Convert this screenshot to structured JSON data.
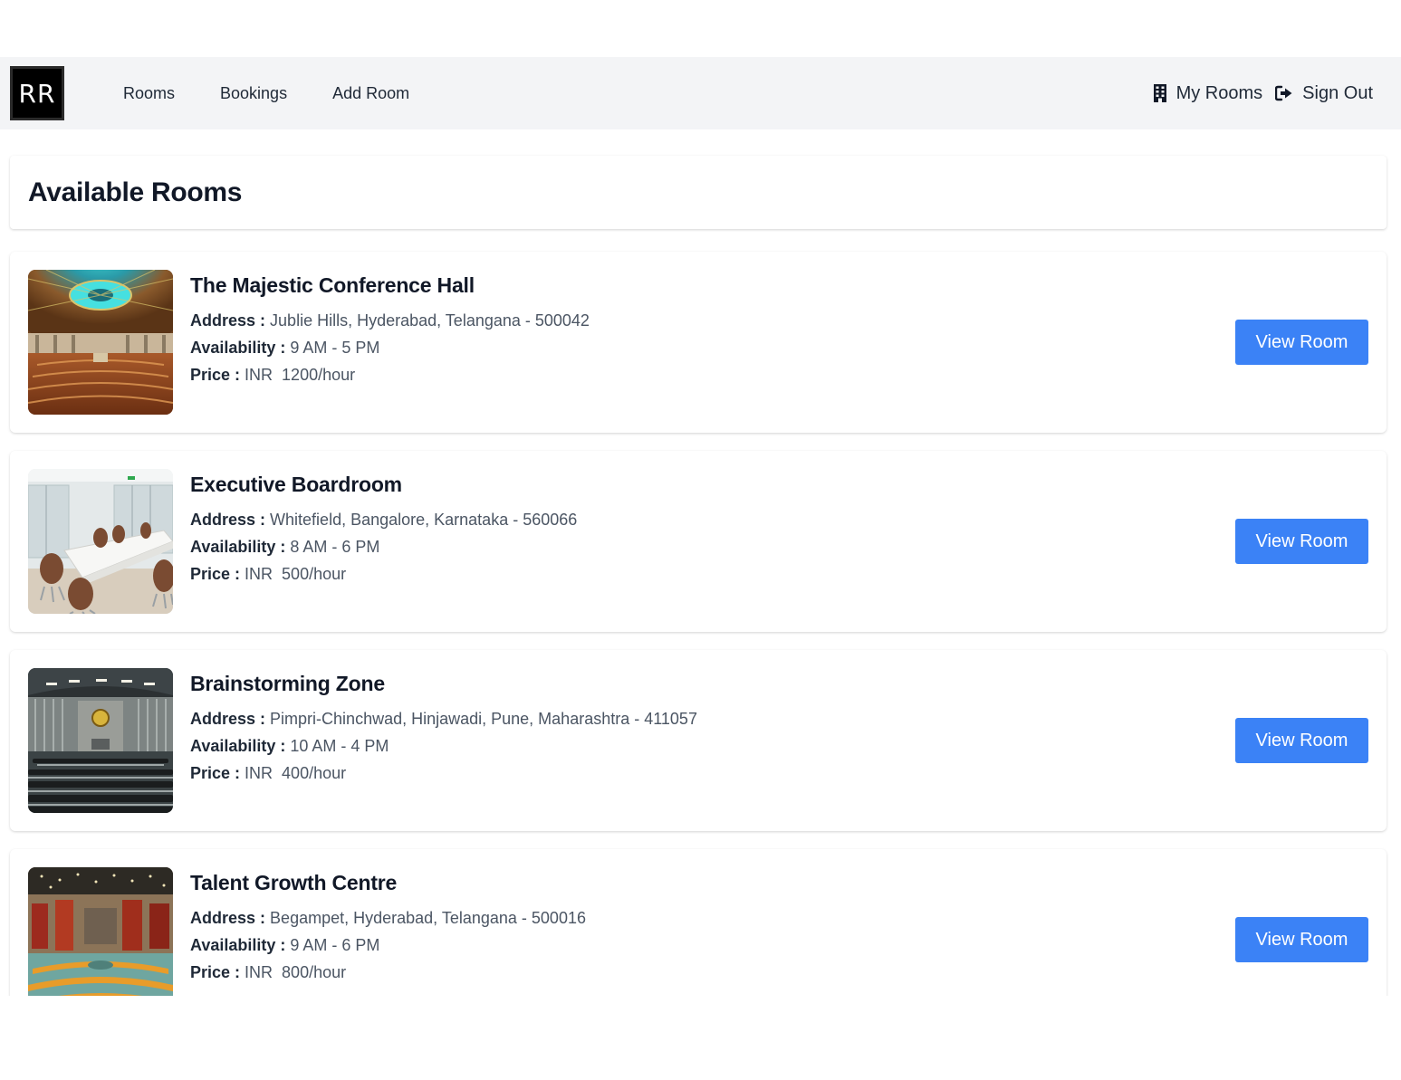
{
  "nav": {
    "logo_text": "RR",
    "links": [
      {
        "label": "Rooms"
      },
      {
        "label": "Bookings"
      },
      {
        "label": "Add Room"
      }
    ],
    "my_rooms": {
      "label": "My Rooms",
      "icon": "building-icon"
    },
    "sign_out": {
      "label": "Sign Out",
      "icon": "sign-out-icon"
    }
  },
  "page": {
    "title": "Available Rooms"
  },
  "labels": {
    "address": "Address :",
    "availability": "Availability :",
    "price": "Price :",
    "view_button": "View Room"
  },
  "rooms": [
    {
      "name": "The Majestic Conference Hall",
      "address": "Jublie Hills, Hyderabad, Telangana - 500042",
      "availability": "9 AM - 5 PM",
      "price": "INR  1200/hour",
      "image": "domed-auditorium-image"
    },
    {
      "name": "Executive Boardroom",
      "address": "Whitefield, Bangalore, Karnataka - 560066",
      "availability": "8 AM - 6 PM",
      "price": "INR  500/hour",
      "image": "boardroom-table-image"
    },
    {
      "name": "Brainstorming Zone",
      "address": "Pimpri-Chinchwad, Hinjawadi, Pune, Maharashtra - 411057",
      "availability": "10 AM - 4 PM",
      "price": "INR  400/hour",
      "image": "assembly-hall-image"
    },
    {
      "name": "Talent Growth Centre",
      "address": "Begampet, Hyderabad, Telangana - 500016",
      "availability": "9 AM - 6 PM",
      "price": "INR  800/hour",
      "image": "parliament-chamber-image"
    }
  ],
  "colors": {
    "accent": "#3b82f6",
    "navbar_bg": "#f3f4f6",
    "text_dark": "#111827",
    "text_muted": "#4b5563"
  }
}
